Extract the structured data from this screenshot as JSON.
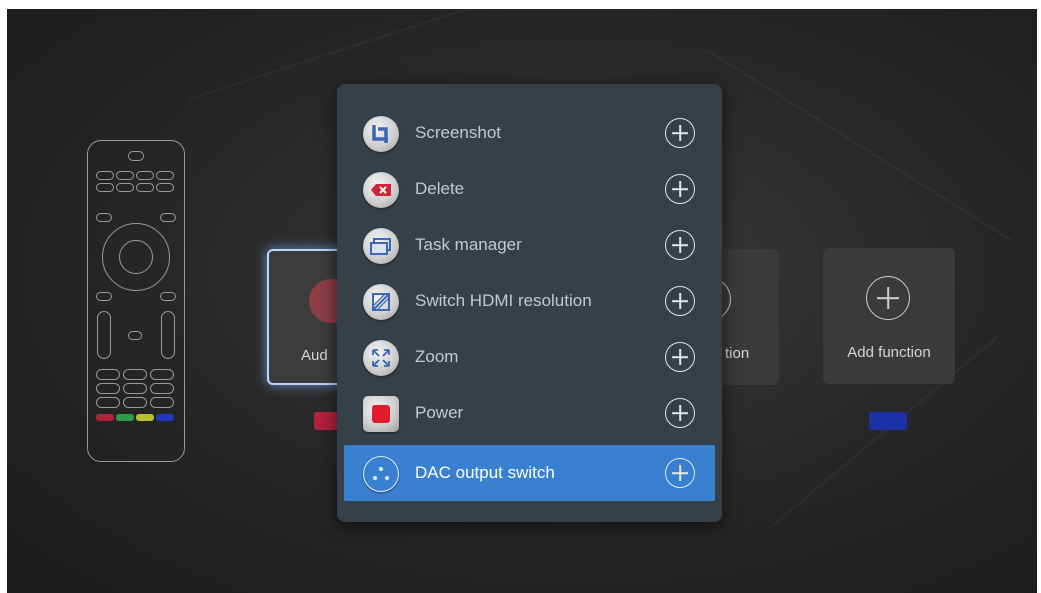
{
  "background_tiles": [
    {
      "label": "Aud",
      "selected": true
    },
    {
      "label": "tion",
      "selected": false
    },
    {
      "label": "Add function",
      "selected": false
    }
  ],
  "color_keys": {
    "red": "#b3223b",
    "green": "#2f7d4a",
    "yellow": "#9aa52a",
    "blue": "#1c30a8"
  },
  "popup": {
    "items": [
      {
        "label": "Screenshot",
        "icon": "crop-icon",
        "active": false
      },
      {
        "label": "Delete",
        "icon": "backspace-icon",
        "active": false
      },
      {
        "label": "Task manager",
        "icon": "windows-icon",
        "active": false
      },
      {
        "label": "Switch HDMI resolution",
        "icon": "resolution-icon",
        "active": false
      },
      {
        "label": "Zoom",
        "icon": "expand-arrows-icon",
        "active": false
      },
      {
        "label": "Power",
        "icon": "power-icon",
        "active": false
      },
      {
        "label": "DAC output switch",
        "icon": "audio-output-icon",
        "active": true
      }
    ]
  },
  "colors": {
    "accent": "#3a80d0",
    "popup_bg": "#364049"
  }
}
